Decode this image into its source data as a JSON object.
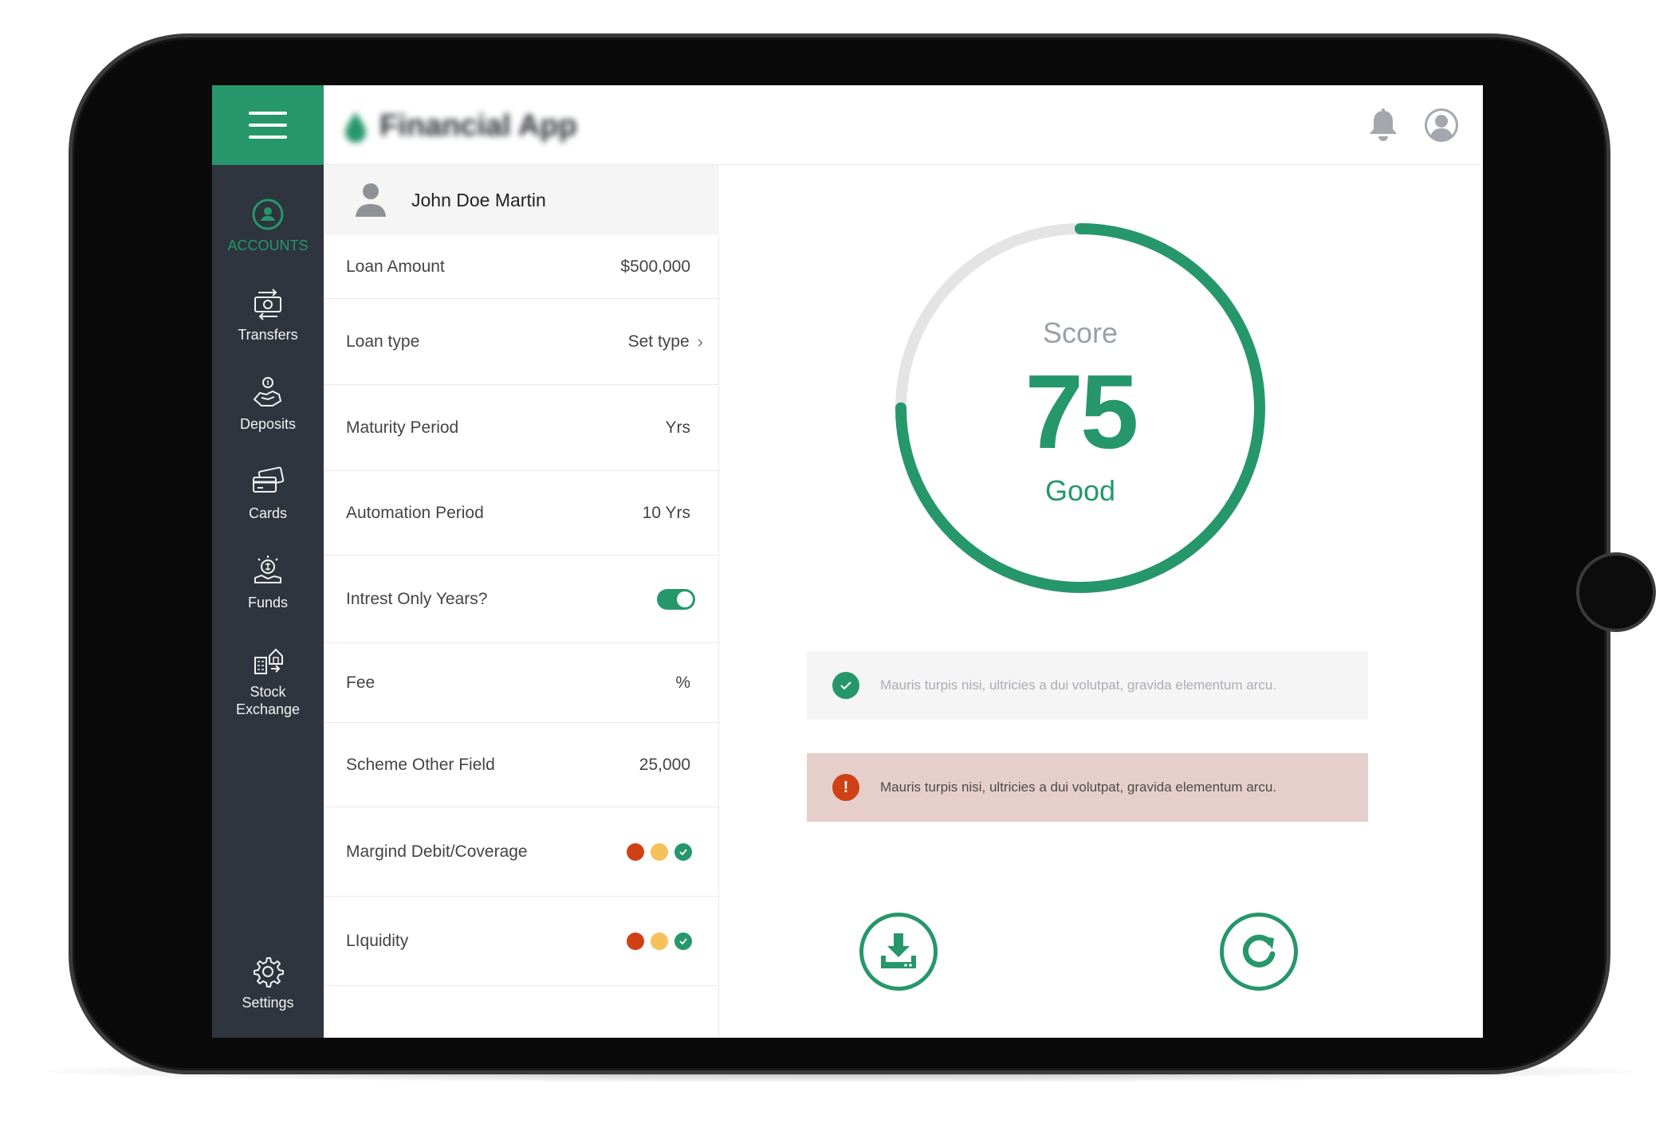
{
  "app": {
    "title": "Financial App"
  },
  "colors": {
    "brand": "#26976a",
    "sidebar": "#2e353f",
    "error": "#cf4115",
    "warning": "#f6c15c"
  },
  "sidebar": {
    "items": [
      {
        "label": "ACCOUNTS",
        "icon": "user-circle-icon",
        "active": true
      },
      {
        "label": "Transfers",
        "icon": "money-transfer-icon"
      },
      {
        "label": "Deposits",
        "icon": "deposit-icon"
      },
      {
        "label": "Cards",
        "icon": "cards-icon"
      },
      {
        "label": "Funds",
        "icon": "funds-icon"
      },
      {
        "label": "Stock\nExchange",
        "icon": "stock-exchange-icon"
      },
      {
        "label": "Settings",
        "icon": "gear-icon"
      }
    ]
  },
  "user": {
    "name": "John Doe Martin"
  },
  "form": {
    "loan_amount": {
      "label": "Loan Amount",
      "value": "$500,000"
    },
    "loan_type": {
      "label": "Loan type",
      "value": "Set type"
    },
    "maturity_period": {
      "label": "Maturity Period",
      "value": "Yrs"
    },
    "automation_period": {
      "label": "Automation Period",
      "value": "10 Yrs"
    },
    "interest_only": {
      "label": "Intrest Only Years?",
      "enabled": true
    },
    "fee": {
      "label": "Fee",
      "value": "%"
    },
    "scheme_other": {
      "label": "Scheme Other Field",
      "value": "25,000"
    },
    "margin_debit": {
      "label": "Margind Debit/Coverage",
      "status": [
        "red",
        "yellow",
        "green-check"
      ]
    },
    "liquidity": {
      "label": "LIquidity",
      "status": [
        "red",
        "yellow",
        "green-check"
      ]
    }
  },
  "score": {
    "label": "Score",
    "value": "75",
    "rating": "Good",
    "progress": 0.75
  },
  "messages": {
    "success": "Mauris turpis nisi, ultricies a dui volutpat, gravida elementum arcu.",
    "error": "Mauris turpis nisi, ultricies a dui volutpat, gravida elementum arcu."
  }
}
